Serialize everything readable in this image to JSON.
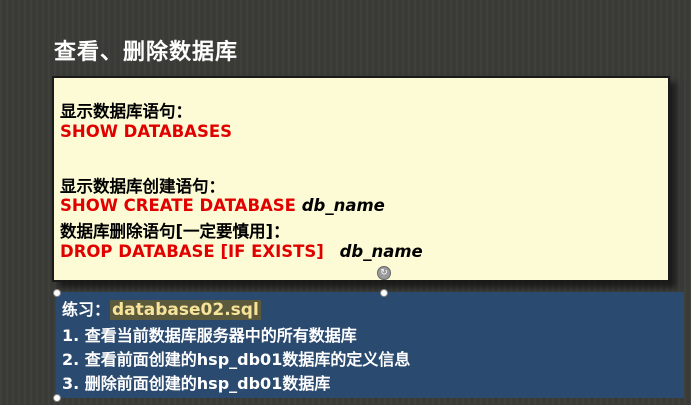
{
  "title": "查看、删除数据库",
  "syntax": {
    "show_db_label": "显示数据库语句：",
    "show_db_cmd": "SHOW DATABASES",
    "show_create_label": "显示数据库创建语句：",
    "show_create_cmd": "SHOW CREATE DATABASE",
    "show_create_arg": "db_name",
    "drop_label": "数据库删除语句[一定要慎用]：",
    "drop_cmd": "DROP DATABASE  [IF EXISTS]",
    "drop_arg": "db_name"
  },
  "exercise": {
    "label": "练习：",
    "file": "database02.sql",
    "items": [
      "1. 查看当前数据库服务器中的所有数据库",
      "2. 查看前面创建的hsp_db01数据库的定义信息",
      "3. 删除前面创建的hsp_db01数据库"
    ]
  },
  "icons": {
    "rotate_handle": "rotate-icon"
  },
  "colors": {
    "background": "#3a3b37",
    "syntax_box": "#fdfbd5",
    "keyword": "#e10000",
    "exercise_box": "#2a4a6f",
    "file_highlight": "#f7e39a"
  }
}
